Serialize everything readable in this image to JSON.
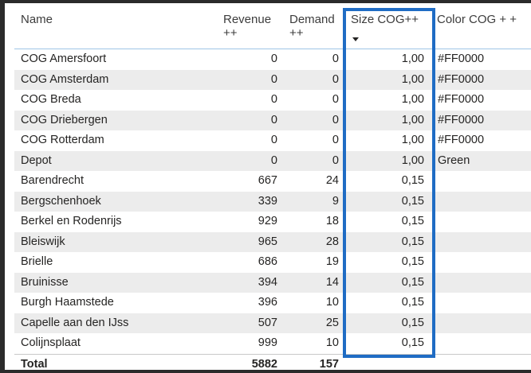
{
  "table": {
    "headers": {
      "name": "Name",
      "revenue": "Revenue ++",
      "demand": "Demand ++",
      "size": "Size COG++",
      "color": "Color COG + +"
    },
    "sorted_column": "Size COG++",
    "sort_direction": "descending",
    "rows": [
      {
        "name": "COG Amersfoort",
        "revenue": "0",
        "demand": "0",
        "size": "1,00",
        "color": "#FF0000"
      },
      {
        "name": "COG Amsterdam",
        "revenue": "0",
        "demand": "0",
        "size": "1,00",
        "color": "#FF0000"
      },
      {
        "name": "COG Breda",
        "revenue": "0",
        "demand": "0",
        "size": "1,00",
        "color": "#FF0000"
      },
      {
        "name": "COG Driebergen",
        "revenue": "0",
        "demand": "0",
        "size": "1,00",
        "color": "#FF0000"
      },
      {
        "name": "COG Rotterdam",
        "revenue": "0",
        "demand": "0",
        "size": "1,00",
        "color": "#FF0000"
      },
      {
        "name": "Depot",
        "revenue": "0",
        "demand": "0",
        "size": "1,00",
        "color": "Green"
      },
      {
        "name": "Barendrecht",
        "revenue": "667",
        "demand": "24",
        "size": "0,15",
        "color": ""
      },
      {
        "name": "Bergschenhoek",
        "revenue": "339",
        "demand": "9",
        "size": "0,15",
        "color": ""
      },
      {
        "name": "Berkel en Rodenrijs",
        "revenue": "929",
        "demand": "18",
        "size": "0,15",
        "color": ""
      },
      {
        "name": "Bleiswijk",
        "revenue": "965",
        "demand": "28",
        "size": "0,15",
        "color": ""
      },
      {
        "name": "Brielle",
        "revenue": "686",
        "demand": "19",
        "size": "0,15",
        "color": ""
      },
      {
        "name": "Bruinisse",
        "revenue": "394",
        "demand": "14",
        "size": "0,15",
        "color": ""
      },
      {
        "name": "Burgh Haamstede",
        "revenue": "396",
        "demand": "10",
        "size": "0,15",
        "color": ""
      },
      {
        "name": "Capelle aan den IJss",
        "revenue": "507",
        "demand": "25",
        "size": "0,15",
        "color": ""
      },
      {
        "name": "Colijnsplaat",
        "revenue": "999",
        "demand": "10",
        "size": "0,15",
        "color": ""
      }
    ],
    "total": {
      "label": "Total",
      "revenue": "5882",
      "demand": "157"
    }
  },
  "colors": {
    "highlight_border": "#1f6cc4",
    "header_underline": "#9fc5e6",
    "row_stripe": "#ececec"
  }
}
